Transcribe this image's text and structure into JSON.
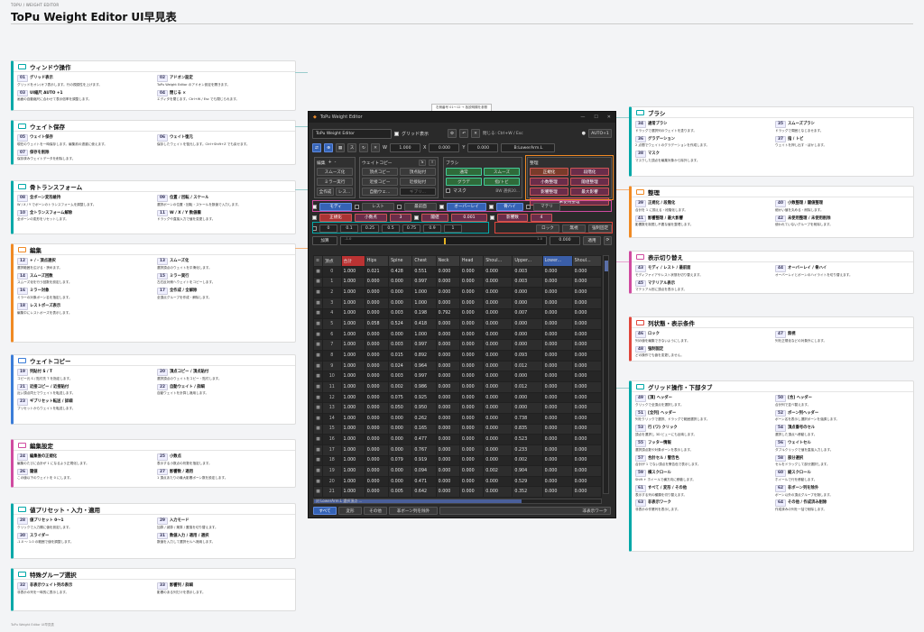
{
  "header": {
    "crumb": "TOPU / WEIGHT EDITOR",
    "title": "ToPu Weight Editor  UI早見表"
  },
  "footer": "ToPu Weight Editor UI早見表",
  "editor": {
    "caption": "右側番号 01〜12 → 各説明欄を参照",
    "window_title": "ToPu Weight Editor",
    "tab": "ToPu Weight Editor",
    "grid_toggle": "グリッド表示",
    "close_hint": "閉じる: Ctrl+W / Esc",
    "auto_label": "AUTO+1",
    "w_label": "W",
    "w_value": "1.000",
    "x_label": "X",
    "x_value": "0.000",
    "y_label": "Y",
    "y_value": "0.000",
    "mode_value": "B:LowerArm.L",
    "edit_title": "編集",
    "edit_buttons": [
      "スムーズ化",
      "ミラー実行",
      "全作成",
      "レス..."
    ],
    "copy_title": "ウェイトコピー",
    "copy_buttons": [
      "頂点コピー",
      "頂点貼付",
      "近接コピー",
      "近接貼付",
      "自動ウェ...",
      "ギブリ..."
    ],
    "copy_st": [
      "S",
      "T"
    ],
    "brush_title": "ブラシ",
    "brush_buttons": [
      "通常",
      "スムーズ",
      "グラデ",
      "指/トビ"
    ],
    "mask_label": "マスク",
    "mask_value": "BW 選択20...",
    "maint_title": "整理",
    "maint_buttons": [
      "正規化",
      "段階化",
      "小数整理",
      "閾値整理",
      "影響整理",
      "最大影響",
      "未使用整理"
    ],
    "row1": [
      "モディ",
      "レスト",
      "最前面",
      "オーバーレイ",
      "骨ハイ",
      "マテリ"
    ],
    "row2": {
      "a": "正規化",
      "b": "小数点",
      "c": "3",
      "d": "閾値",
      "e": "0.001",
      "f": "影響数",
      "g": "4"
    },
    "presets": [
      "0",
      "0.1",
      "0.25",
      "0.5",
      "0.75",
      "0.9",
      "1"
    ],
    "row3": [
      "ロック",
      "無視",
      "強制固定"
    ],
    "add_label": "加算",
    "slider_value": "0.000",
    "slider_min": "-1.0",
    "slider_max": "1.0",
    "apply": "適用",
    "columns": [
      "頂点",
      "合計",
      "Hips",
      "Spine",
      "Chest",
      "Neck",
      "Head",
      "Shoul...",
      "Upper...",
      "Lower...",
      "Shoul..."
    ],
    "rows": [
      [
        "0",
        "1.000",
        "0.021",
        "0.428",
        "0.551",
        "0.000",
        "0.000",
        "0.000",
        "0.003",
        "0.000",
        "0.000"
      ],
      [
        "1",
        "1.000",
        "0.000",
        "0.000",
        "0.997",
        "0.000",
        "0.000",
        "0.000",
        "0.003",
        "0.000",
        "0.000"
      ],
      [
        "2",
        "1.000",
        "0.000",
        "0.000",
        "1.000",
        "0.000",
        "0.000",
        "0.000",
        "0.000",
        "0.000",
        "0.000"
      ],
      [
        "3",
        "1.000",
        "0.000",
        "0.000",
        "1.000",
        "0.000",
        "0.000",
        "0.000",
        "0.000",
        "0.000",
        "0.000"
      ],
      [
        "4",
        "1.000",
        "0.000",
        "0.003",
        "0.198",
        "0.792",
        "0.000",
        "0.000",
        "0.007",
        "0.000",
        "0.000"
      ],
      [
        "5",
        "1.000",
        "0.058",
        "0.524",
        "0.418",
        "0.000",
        "0.000",
        "0.000",
        "0.000",
        "0.000",
        "0.000"
      ],
      [
        "6",
        "1.000",
        "0.000",
        "0.000",
        "1.000",
        "0.000",
        "0.000",
        "0.000",
        "0.000",
        "0.000",
        "0.000"
      ],
      [
        "7",
        "1.000",
        "0.000",
        "0.003",
        "0.997",
        "0.000",
        "0.000",
        "0.000",
        "0.000",
        "0.000",
        "0.000"
      ],
      [
        "8",
        "1.000",
        "0.000",
        "0.015",
        "0.892",
        "0.000",
        "0.000",
        "0.000",
        "0.093",
        "0.000",
        "0.000"
      ],
      [
        "9",
        "1.000",
        "0.000",
        "0.024",
        "0.964",
        "0.000",
        "0.000",
        "0.000",
        "0.012",
        "0.000",
        "0.000"
      ],
      [
        "10",
        "1.000",
        "0.000",
        "0.003",
        "0.997",
        "0.000",
        "0.000",
        "0.000",
        "0.000",
        "0.000",
        "0.000"
      ],
      [
        "11",
        "1.000",
        "0.000",
        "0.002",
        "0.986",
        "0.000",
        "0.000",
        "0.000",
        "0.012",
        "0.000",
        "0.000"
      ],
      [
        "12",
        "1.000",
        "0.000",
        "0.075",
        "0.925",
        "0.000",
        "0.000",
        "0.000",
        "0.000",
        "0.000",
        "0.000"
      ],
      [
        "13",
        "1.000",
        "0.000",
        "0.050",
        "0.950",
        "0.000",
        "0.000",
        "0.000",
        "0.000",
        "0.000",
        "0.000"
      ],
      [
        "14",
        "1.000",
        "0.000",
        "0.000",
        "0.262",
        "0.000",
        "0.000",
        "0.000",
        "0.738",
        "0.000",
        "0.000"
      ],
      [
        "15",
        "1.000",
        "0.000",
        "0.000",
        "0.165",
        "0.000",
        "0.000",
        "0.000",
        "0.835",
        "0.000",
        "0.000"
      ],
      [
        "16",
        "1.000",
        "0.000",
        "0.000",
        "0.477",
        "0.000",
        "0.000",
        "0.000",
        "0.523",
        "0.000",
        "0.000"
      ],
      [
        "17",
        "1.000",
        "0.000",
        "0.000",
        "0.767",
        "0.000",
        "0.000",
        "0.000",
        "0.233",
        "0.000",
        "0.000"
      ],
      [
        "18",
        "1.000",
        "0.000",
        "0.079",
        "0.919",
        "0.000",
        "0.000",
        "0.000",
        "0.002",
        "0.000",
        "0.000"
      ],
      [
        "19",
        "1.000",
        "0.000",
        "0.000",
        "0.094",
        "0.000",
        "0.000",
        "0.002",
        "0.904",
        "0.000",
        "0.000"
      ],
      [
        "20",
        "1.000",
        "0.000",
        "0.000",
        "0.471",
        "0.000",
        "0.000",
        "0.000",
        "0.529",
        "0.000",
        "0.000"
      ],
      [
        "21",
        "1.000",
        "0.000",
        "0.005",
        "0.642",
        "0.000",
        "0.000",
        "0.000",
        "0.352",
        "0.000",
        "0.000"
      ]
    ],
    "status": "対 LowerArm.L 選択頂点 ...",
    "tabs": [
      "すべて",
      "変形",
      "その他",
      "非ボーン列を除外",
      "非表示ワーク"
    ]
  },
  "left_sections": [
    {
      "title": "ウィンドウ操作",
      "color": "#00a8a8",
      "items": [
        {
          "k": "01",
          "t": "グリッド表示",
          "d": "グリッドをオン/オフ表示します。行の視認性を上げます。"
        },
        {
          "k": "02",
          "t": "アドオン設定",
          "d": "ToPu Weight Editor のアドオン設定を開きます。"
        },
        {
          "k": "03",
          "t": "UI縮尺 AUTO +1",
          "d": "画面の自動縮尺に合わせて表示倍率を調整します。"
        },
        {
          "k": "04",
          "t": "閉じる ×",
          "d": "エディタを閉じます。Ctrl+W / Esc でも閉じられます。"
        }
      ]
    },
    {
      "title": "ウェイト保存",
      "color": "#00a8a8",
      "items": [
        {
          "k": "05",
          "t": "ウェイト保存",
          "d": "現在のウェイトを一時保存します。編集前の退避に使えます。"
        },
        {
          "k": "06",
          "t": "ウェイト復元",
          "d": "保存したウェイトを復元します。Ctrl+Shift+Z でも戻せます。"
        },
        {
          "k": "07",
          "t": "保存を削除",
          "d": "保存済みウェイトデータを削除します。"
        }
      ]
    },
    {
      "title": "骨トランスフォーム",
      "color": "#00a8a8",
      "items": [
        {
          "k": "08",
          "t": "全ボーン変形維持",
          "d": "W / X / Y でボーンのトランスフォームを調整します。"
        },
        {
          "k": "09",
          "t": "位置 / 回転 / スケール",
          "d": "選択ボーンの位置・回転・スケールを数値で入力します。"
        },
        {
          "k": "10",
          "t": "全トランスフォーム解除",
          "d": "全ボーンの変形をリセットします。"
        },
        {
          "k": "11",
          "t": "W / X / Y 数値欄",
          "d": "ドラッグや直接入力で値を変更します。"
        }
      ]
    },
    {
      "title": "編集",
      "color": "#f08a24",
      "items": [
        {
          "k": "12",
          "t": "+ / - 頂点選択",
          "d": "選択範囲を広げる・狭めます。"
        },
        {
          "k": "13",
          "t": "スムーズ化",
          "d": "選択頂点のウェイトを平滑化します。"
        },
        {
          "k": "14",
          "t": "スムーズ回数",
          "d": "スムーズ化を行う回数を設定します。"
        },
        {
          "k": "15",
          "t": "ミラー実行",
          "d": "左右反対側へウェイトをコピーします。"
        },
        {
          "k": "16",
          "t": "ミラー対象",
          "d": "ミラーの対象ボーン名を指定します。"
        },
        {
          "k": "17",
          "t": "全作成 / 全解除",
          "d": "全頂点グループを作成・解除します。"
        },
        {
          "k": "18",
          "t": "レストポーズ表示",
          "d": "編集中にレストポーズを表示します。"
        }
      ]
    },
    {
      "title": "ウェイトコピー",
      "color": "#3b7dd8",
      "items": [
        {
          "k": "19",
          "t": "列貼付 S / T",
          "d": "コピー元 S / 貼付先 T を指定します。"
        },
        {
          "k": "20",
          "t": "頂点コピー / 頂点貼付",
          "d": "選択頂点のウェイトをコピー・貼付します。"
        },
        {
          "k": "21",
          "t": "近接コピー / 近接貼付",
          "d": "近い頂点同士でウェイトを転送します。"
        },
        {
          "k": "22",
          "t": "自動ウェイト / 詳細",
          "d": "自動ウェイトを計算し適用します。"
        },
        {
          "k": "23",
          "t": "ギブリセット転送 / 詳細",
          "d": "プリセットからウェイトを転送します。"
        }
      ]
    },
    {
      "title": "編集設定",
      "color": "#d04aa0",
      "items": [
        {
          "k": "24",
          "t": "編集後の正規化",
          "d": "編集のたびに合計が 1 になるよう正規化します。"
        },
        {
          "k": "25",
          "t": "小数点",
          "d": "表示する小数点の桁数を指定します。"
        },
        {
          "k": "26",
          "t": "閾値",
          "d": "この値以下のウェイトを 0 にします。"
        },
        {
          "k": "27",
          "t": "影響数 / 適用",
          "d": "1 頂点あたりの最大影響ボーン数を設定します。"
        }
      ]
    },
    {
      "title": "値プリセット・入力・適用",
      "color": "#00a8a8",
      "items": [
        {
          "k": "28",
          "t": "値プリセット 0〜1",
          "d": "クリックで入力欄に値を設定します。"
        },
        {
          "k": "29",
          "t": "入力モード",
          "d": "加算 / 減算 / 乗算 / 置換を切り替えます。"
        },
        {
          "k": "30",
          "t": "スライダー",
          "d": "-1.0 〜 1.0 の範囲で値を調整します。"
        },
        {
          "k": "31",
          "t": "数値入力 / 適用 / 選択",
          "d": "数値を入力して選択セルへ適用します。"
        }
      ]
    },
    {
      "title": "特殊グループ選択",
      "color": "#00a8a8",
      "items": [
        {
          "k": "32",
          "t": "非表示ウェイト列の表示",
          "d": "非表示の列を一時的に表示します。"
        },
        {
          "k": "33",
          "t": "影響列 / 詳細",
          "d": "影響のある列だけを表示します。"
        }
      ]
    }
  ],
  "right_sections": [
    {
      "title": "ブラシ",
      "color": "#00a8a8",
      "items": [
        {
          "k": "34",
          "t": "通常ブラシ",
          "d": "ドラッグで選択列のウェイトを塗ります。"
        },
        {
          "k": "35",
          "t": "スムーズブラシ",
          "d": "ドラッグで周囲となじませます。"
        },
        {
          "k": "36",
          "t": "グラデーション",
          "d": "2 点間でウェイトのグラデーションを作成します。"
        },
        {
          "k": "37",
          "t": "指 / トビ",
          "d": "ウェイトを押し出す・ぼかします。"
        },
        {
          "k": "38",
          "t": "マスク",
          "d": "マスクした頂点を編集対象から除外します。"
        }
      ]
    },
    {
      "title": "整理",
      "color": "#f08a24",
      "items": [
        {
          "k": "39",
          "t": "正規化 / 段階化",
          "d": "合計を 1 に揃える・段階化します。"
        },
        {
          "k": "40",
          "t": "小数整理 / 閾値整理",
          "d": "細かい値を丸める・削除します。"
        },
        {
          "k": "41",
          "t": "影響整理 / 最大影響",
          "d": "影響数を制限し不要な値を整理します。"
        },
        {
          "k": "42",
          "t": "未使用整理 / 未使用削除",
          "d": "使われていないグループを削除します。"
        }
      ]
    },
    {
      "title": "表示切り替え",
      "color": "#d04aa0",
      "items": [
        {
          "k": "43",
          "t": "モディ / レスト / 最前面",
          "d": "モディファイアやレスト状態を切り替えます。"
        },
        {
          "k": "44",
          "t": "オーバーレイ / 骨ハイ",
          "d": "オーバーレイとボーンのハイライトを切り替えます。"
        },
        {
          "k": "45",
          "t": "マテリアル表示",
          "d": "マテリアル別に頂点を表示します。"
        }
      ]
    },
    {
      "title": "列状態・表示条件",
      "color": "#e0463c",
      "items": [
        {
          "k": "46",
          "t": "ロック",
          "d": "列の値を編集できないようにします。"
        },
        {
          "k": "47",
          "t": "無視",
          "d": "列を正規化などの対象外にします。"
        },
        {
          "k": "48",
          "t": "強制固定",
          "d": "どの操作でも値を変更しません。"
        }
      ]
    },
    {
      "title": "グリッド操作・下部タブ",
      "color": "#00a8a8",
      "items": [
        {
          "k": "49",
          "t": "[頂] ヘッダー",
          "d": "クリックで全頂点を選択します。"
        },
        {
          "k": "50",
          "t": "[合] ヘッダー",
          "d": "合計列で並べ替えます。"
        },
        {
          "k": "51",
          "t": "[全列] ヘッダー",
          "d": "列をクリックで選択、ドラッグで範囲選択します。"
        },
        {
          "k": "52",
          "t": "ボーン列ヘッダー",
          "d": "ボーン名を表示し選択ボーンを強調します。"
        },
        {
          "k": "53",
          "t": "行 (ワ) クリック",
          "d": "頂点を選択し 3D ビューにも反映します。"
        },
        {
          "k": "54",
          "t": "頂点番号のセル",
          "d": "選択した頂点へ移動します。"
        },
        {
          "k": "55",
          "t": "フッター情報",
          "d": "選択頂点数や対象ボーンを表示します。"
        },
        {
          "k": "56",
          "t": "ウェイトセル",
          "d": "ダブルクリックで値を直接入力します。"
        },
        {
          "k": "57",
          "t": "合計セル / 警告色",
          "d": "合計が 1 でない頂点を警告色で表示します。"
        },
        {
          "k": "58",
          "t": "部分選択",
          "d": "セルをドラッグして部分選択します。"
        },
        {
          "k": "59",
          "t": "横スクロール",
          "d": "Shift + ホイールで横方向に移動します。"
        },
        {
          "k": "60",
          "t": "縦スクロール",
          "d": "ホイールで行を移動します。"
        },
        {
          "k": "61",
          "t": "すべて / 変形 / その他",
          "d": "表示する列の種類を切り替えます。"
        },
        {
          "k": "62",
          "t": "非ボーン列を除外",
          "d": "ボーン以外の頂点グループを隠します。"
        },
        {
          "k": "63",
          "t": "非表示ワーク",
          "d": "非表示の作業列を表示します。"
        },
        {
          "k": "64",
          "t": "その他 / 作成済み削除",
          "d": "作成済みの列を一括で削除します。"
        }
      ]
    }
  ]
}
